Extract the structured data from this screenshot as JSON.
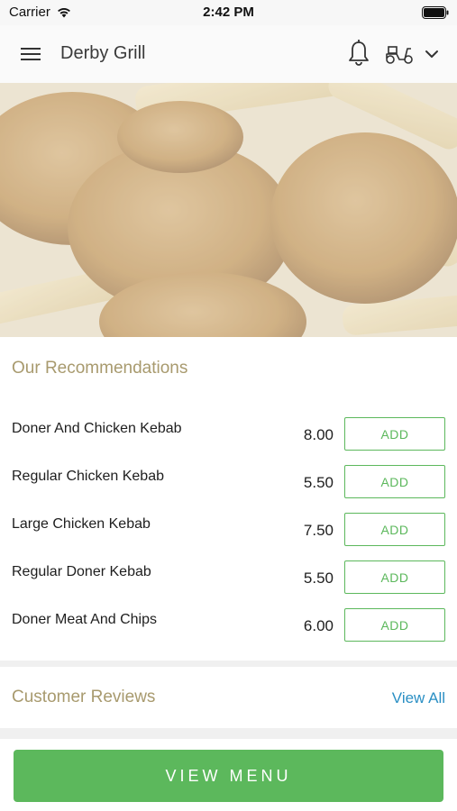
{
  "status_bar": {
    "carrier": "Carrier",
    "time": "2:42 PM"
  },
  "header": {
    "title": "Derby Grill"
  },
  "recommendations": {
    "title": "Our Recommendations",
    "add_label": "ADD",
    "items": [
      {
        "name": "Doner And Chicken Kebab",
        "price": "8.00"
      },
      {
        "name": "Regular Chicken Kebab",
        "price": "5.50"
      },
      {
        "name": "Large Chicken Kebab",
        "price": "7.50"
      },
      {
        "name": "Regular Doner Kebab",
        "price": "5.50"
      },
      {
        "name": "Doner Meat And Chips",
        "price": "6.00"
      }
    ]
  },
  "reviews": {
    "title": "Customer Reviews",
    "view_all": "View All"
  },
  "footer": {
    "view_menu": "VIEW MENU"
  },
  "colors": {
    "accent_green": "#5cb85c",
    "section_title": "#a89a6e",
    "link_blue": "#2a8fc4"
  }
}
